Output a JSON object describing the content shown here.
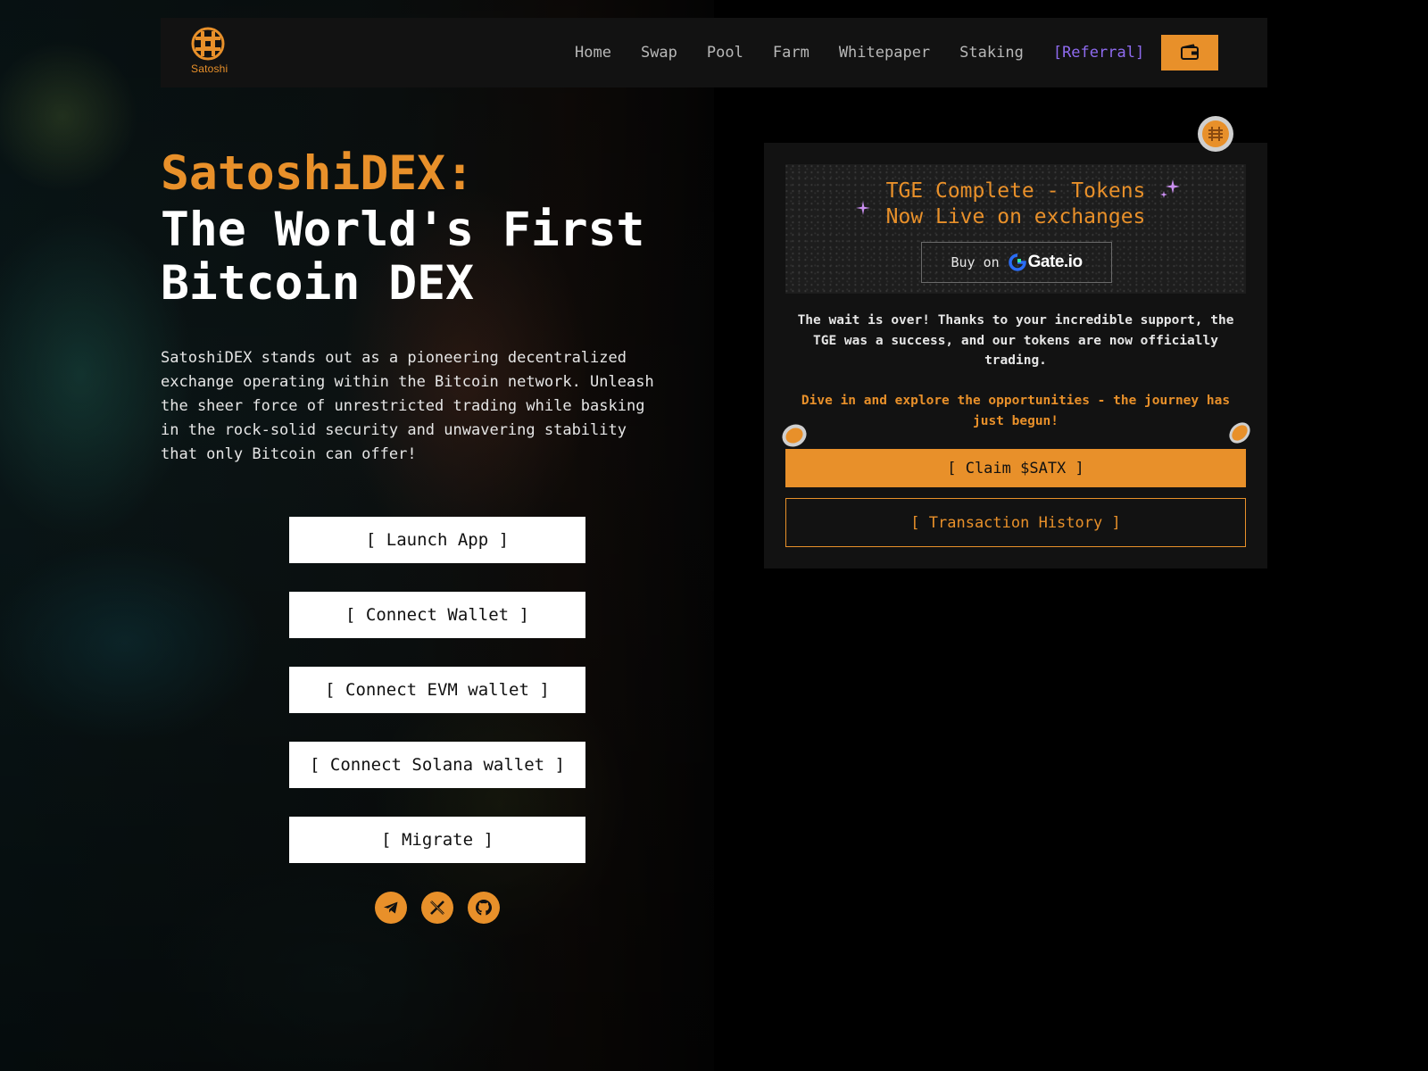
{
  "brand": {
    "logo_text": "Satoshi",
    "accent": "#e8902a",
    "referral_color": "#8f6bf0"
  },
  "nav": {
    "items": [
      {
        "label": "Home"
      },
      {
        "label": "Swap"
      },
      {
        "label": "Pool"
      },
      {
        "label": "Farm"
      },
      {
        "label": "Whitepaper"
      },
      {
        "label": "Staking"
      }
    ],
    "referral_label": "[Referral]",
    "wallet_icon": "wallet-icon"
  },
  "hero": {
    "title_line1": "SatoshiDEX:",
    "title_line2": "The World's First Bitcoin DEX",
    "description": "SatoshiDEX stands out as a pioneering decentralized exchange operating within the Bitcoin network. Unleash the sheer force of unrestricted trading while basking in the rock-solid security and unwavering stability that only Bitcoin can offer!",
    "buttons": [
      {
        "label": "[ Launch App ]"
      },
      {
        "label": "[ Connect Wallet ]"
      },
      {
        "label": "[ Connect EVM wallet ]"
      },
      {
        "label": "[ Connect Solana wallet ]"
      },
      {
        "label": "[ Migrate ]"
      }
    ],
    "socials": [
      "telegram-icon",
      "x-icon",
      "github-icon"
    ]
  },
  "panel": {
    "banner_title_line1": "TGE Complete - Tokens",
    "banner_title_line2": "Now Live on exchanges",
    "buy_label": "Buy on",
    "exchange_name": "Gate.io",
    "message": "The wait is over! Thanks to your incredible support, the TGE was a success, and our tokens are now officially trading.",
    "message_highlight": "Dive in and explore the opportunities - the journey has just begun!",
    "claim_label": "[ Claim $SATX ]",
    "history_label": "[ Transaction History ]"
  }
}
